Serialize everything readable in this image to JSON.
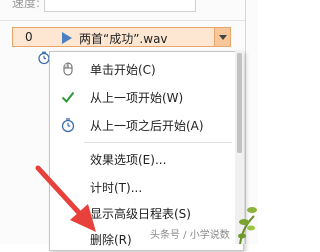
{
  "panel": {
    "speed_label": "速度:"
  },
  "animation_row": {
    "index": "0",
    "name": "两首“成功”.wav"
  },
  "context_menu": {
    "items": [
      {
        "label": "单击开始(C)",
        "icon": "mouse-icon"
      },
      {
        "label": "从上一项开始(W)",
        "icon": "check-icon"
      },
      {
        "label": "从上一项之后开始(A)",
        "icon": "clock-icon"
      },
      {
        "label": "效果选项(E)..."
      },
      {
        "label": "计时(T)..."
      },
      {
        "label": "显示高级日程表(S)"
      },
      {
        "label": "删除(R)"
      }
    ]
  },
  "watermark": "头条号 / 小学说数",
  "colors": {
    "accent_orange": "#e8a66d",
    "selection_fill": "#fde7d2",
    "check_green": "#2c9a3a",
    "play_blue": "#4a7fc1",
    "arrow_red": "#e8413b"
  }
}
